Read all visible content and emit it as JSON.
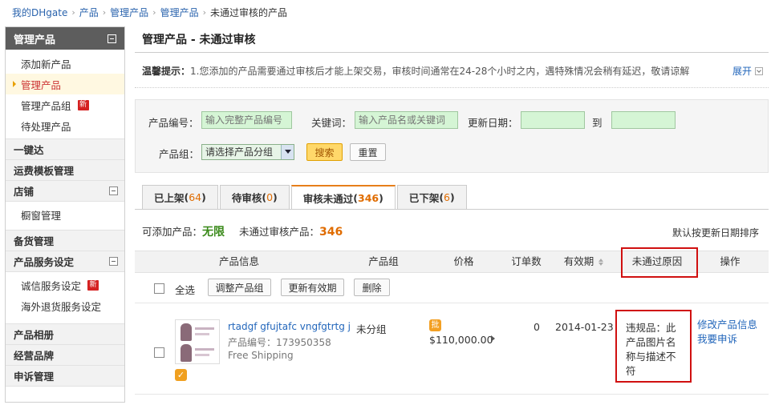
{
  "breadcrumb": {
    "items": [
      "我的DHgate",
      "产品",
      "管理产品",
      "管理产品"
    ],
    "current": "未通过审核的产品"
  },
  "sidebar": {
    "title": "管理产品",
    "sub_items": [
      {
        "label": "添加新产品"
      },
      {
        "label": "管理产品",
        "active": true
      },
      {
        "label": "管理产品组",
        "badge": "新"
      },
      {
        "label": "待处理产品"
      }
    ],
    "groups": {
      "yijianda": "一键达",
      "freight": "运费模板管理",
      "store": "店铺",
      "store_items": [
        "橱窗管理"
      ],
      "stock": "备货管理",
      "service": "产品服务设定",
      "service_items": [
        {
          "label": "诚信服务设定",
          "badge": "新"
        },
        {
          "label": "海外退货服务设定"
        }
      ],
      "album": "产品相册",
      "brand": "经营品牌",
      "appeal": "申诉管理"
    }
  },
  "main": {
    "title": "管理产品 - 未通过审核",
    "notice_label": "温馨提示：",
    "notice_text": "1.您添加的产品需要通过审核后才能上架交易，审核时间通常在24-28个小时之内，遇特殊情况会稍有延迟，敬请谅解",
    "expand": "展开"
  },
  "search": {
    "code_label": "产品编号：",
    "code_placeholder": "输入完整产品编号",
    "keyword_label": "关键词：",
    "keyword_placeholder": "输入产品名或关键词",
    "date_label": "更新日期：",
    "date_to": "到",
    "group_label": "产品组：",
    "group_select": "请选择产品分组",
    "search_btn": "搜索",
    "reset_btn": "重置"
  },
  "tabs": [
    {
      "label": "已上架",
      "count": "64"
    },
    {
      "label": "待审核",
      "count": "0"
    },
    {
      "label": "审核未通过",
      "count": "346",
      "active": true
    },
    {
      "label": "已下架",
      "count": "6"
    }
  ],
  "summary": {
    "addable_label": "可添加产品：",
    "addable_value": "无限",
    "failed_label": "未通过审核产品：",
    "failed_value": "346",
    "sort_note": "默认按更新日期排序"
  },
  "table": {
    "headers": [
      "产品信息",
      "产品组",
      "价格",
      "订单数",
      "有效期",
      "未通过原因",
      "操作"
    ],
    "select_all": "全选",
    "bulk_buttons": [
      "调整产品组",
      "更新有效期",
      "删除"
    ],
    "rows": [
      {
        "name": "rtadgf gfujtafc vngfgtrtg j",
        "code": "产品编号：173950358",
        "shipping": "Free Shipping",
        "group": "未分组",
        "price_badge": "批",
        "price": "$110,000.00",
        "orders": "0",
        "expiry": "2014-01-23",
        "reason": "违规品：此产品图片名称与描述不符",
        "actions": [
          "修改产品信息",
          "我要申诉"
        ]
      }
    ]
  }
}
